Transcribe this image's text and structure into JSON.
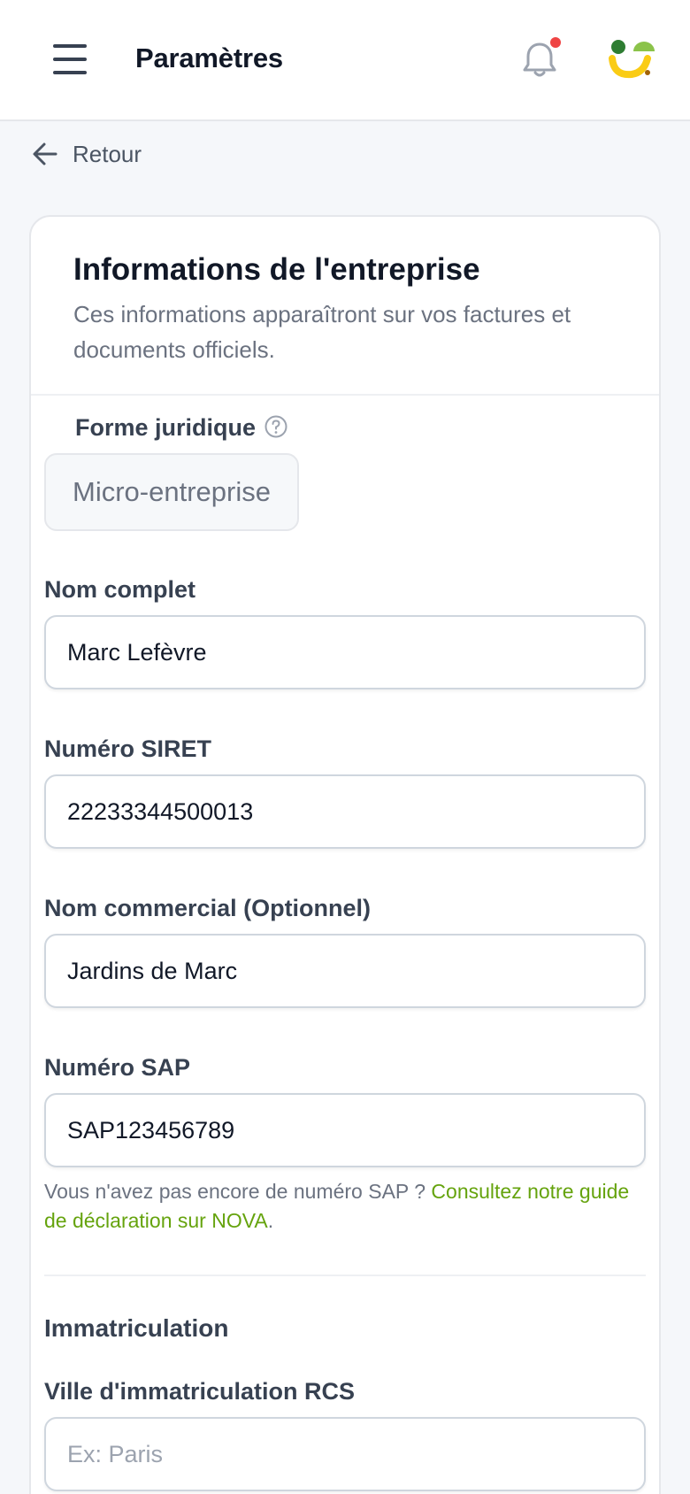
{
  "header": {
    "title": "Paramètres",
    "notification_dot_color": "#ef4444",
    "menu_icon": "hamburger-menu-icon",
    "bell_icon": "bell-icon",
    "logo_colors": [
      "#2e7d32",
      "#8bc34a",
      "#facc15"
    ]
  },
  "nav": {
    "back_label": "Retour"
  },
  "card": {
    "title": "Informations de l'entreprise",
    "subtitle": "Ces informations apparaîtront sur vos factures et documents officiels."
  },
  "form": {
    "legal_form": {
      "label": "Forme juridique",
      "value": "Micro-entreprise"
    },
    "full_name": {
      "label": "Nom complet",
      "value": "Marc Lefèvre"
    },
    "siret": {
      "label": "Numéro SIRET",
      "value": "22233344500013"
    },
    "trade_name": {
      "label": "Nom commercial (Optionnel)",
      "value": "Jardins de Marc"
    },
    "sap": {
      "label": "Numéro SAP",
      "value": "SAP123456789",
      "hint_text": "Vous n'avez pas encore de numéro SAP ? ",
      "hint_link": "Consultez notre guide de déclaration sur NOVA",
      "hint_end": "."
    },
    "registration": {
      "section_title": "Immatriculation",
      "rcs_city": {
        "label": "Ville d'immatriculation RCS",
        "value": "",
        "placeholder": "Ex: Paris"
      }
    }
  },
  "colors": {
    "accent_link": "#65a30d",
    "background": "#f5f7fa"
  }
}
